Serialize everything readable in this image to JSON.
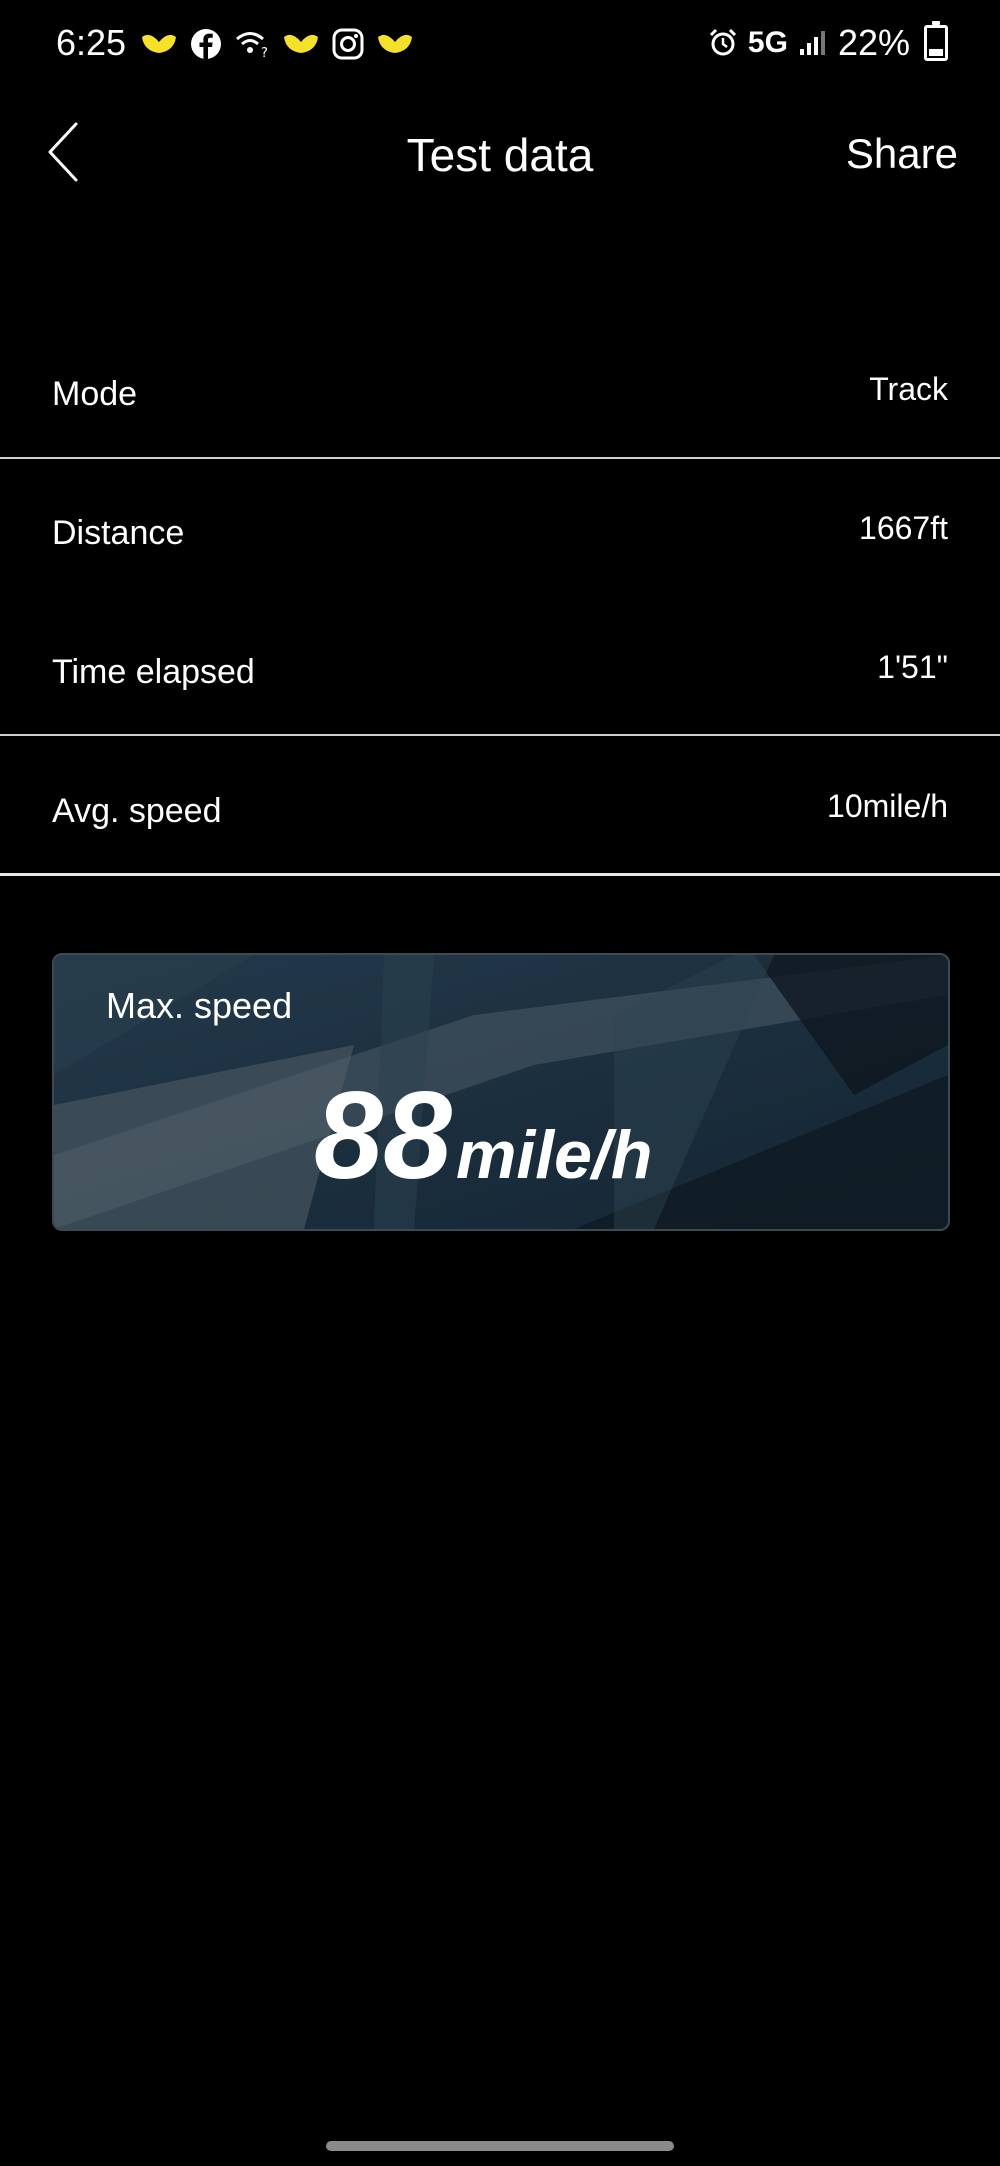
{
  "status_bar": {
    "time": "6:25",
    "network": "5G",
    "battery": "22%"
  },
  "header": {
    "title": "Test data",
    "share_label": "Share"
  },
  "rows": [
    {
      "label": "Mode",
      "value": "Track"
    },
    {
      "label": "Distance",
      "value": "1667ft"
    },
    {
      "label": "Time elapsed",
      "value": "1'51\""
    },
    {
      "label": "Avg. speed",
      "value": "10mile/h"
    }
  ],
  "max_speed": {
    "label": "Max. speed",
    "value": "88",
    "unit": "mile/h"
  },
  "colors": {
    "background": "#000000",
    "card": "#1b2f3d",
    "notification_icon": "#f5e02a"
  }
}
